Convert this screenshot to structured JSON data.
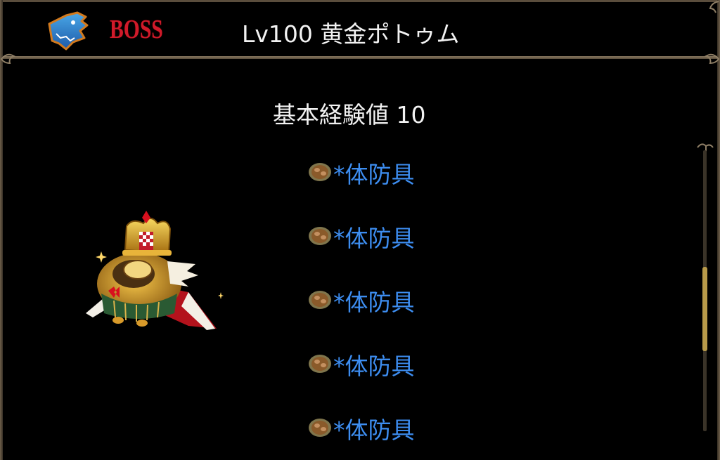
{
  "header": {
    "badge": "BOSS",
    "monster_name": "Lv100 黄金ポトゥム",
    "icon": "dragon-head-icon"
  },
  "info": {
    "exp_text": "基本経験値 10"
  },
  "drops": [
    {
      "label": "*体防具",
      "icon": "pouch-icon"
    },
    {
      "label": "*体防具",
      "icon": "pouch-icon"
    },
    {
      "label": "*体防具",
      "icon": "pouch-icon"
    },
    {
      "label": "*体防具",
      "icon": "pouch-icon"
    },
    {
      "label": "*体防具",
      "icon": "pouch-icon"
    }
  ],
  "colors": {
    "boss_text": "#d11a2a",
    "drop_text": "#3d8df0",
    "frame": "#8a7a62"
  }
}
